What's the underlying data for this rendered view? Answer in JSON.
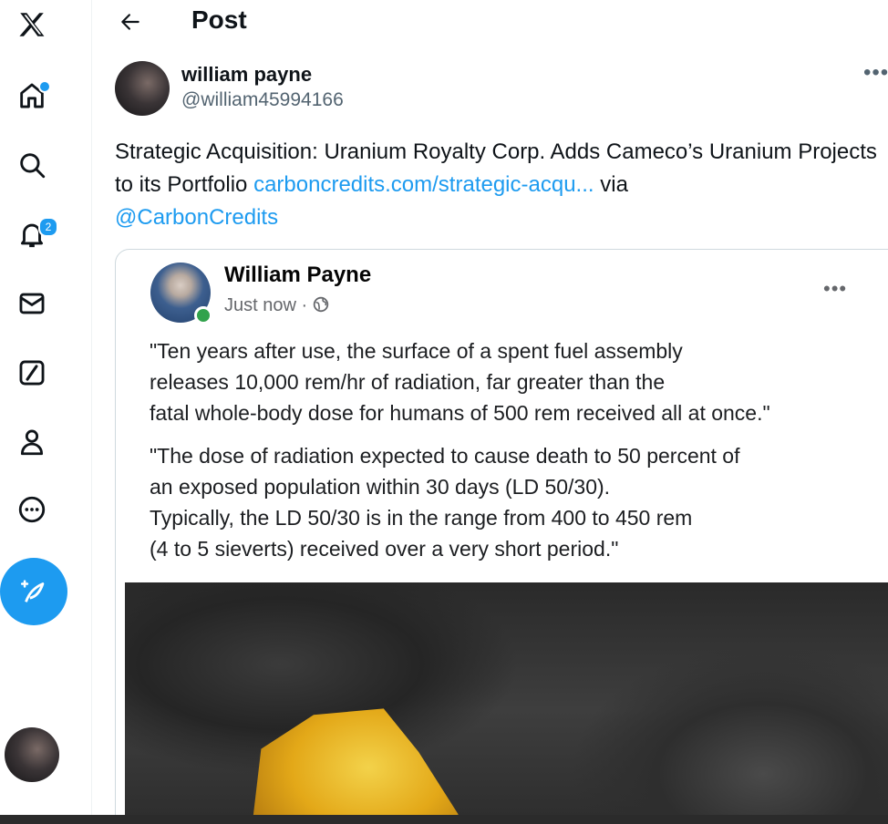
{
  "nav": {
    "logo": "x-logo-icon",
    "items": [
      "home-icon",
      "search-icon",
      "notifications-icon",
      "messages-icon",
      "grok-icon",
      "profile-icon",
      "more-icon"
    ],
    "notification_count": "2"
  },
  "header": {
    "title": "Post"
  },
  "post": {
    "author_name": "william payne",
    "author_handle": "@william45994166",
    "text_1": "Strategic Acquisition: Uranium Royalty Corp. Adds Cameco’s Uranium Projects to its Portfolio ",
    "link": "carboncredits.com/strategic-acqu...",
    "text_2": " via ",
    "mention": "@CarbonCredits"
  },
  "card": {
    "name": "William Payne",
    "time": "Just now · ",
    "para_1_line_1": "\"Ten years after use, the surface of a spent fuel assembly",
    "para_1_line_2": "releases 10,000 rem/hr of radiation, far greater than the",
    "para_1_line_3": "fatal whole-body dose for humans of 500 rem received all at once.\"",
    "para_2_line_1": "\"The dose of radiation expected to cause death to 50 percent of",
    "para_2_line_2": "an exposed population within 30 days (LD 50/30).",
    "para_2_line_3": "Typically, the LD 50/30 is in the range from 400 to 450 rem",
    "para_2_line_4": "(4 to 5 sieverts) received over a very short period.\""
  },
  "colors": {
    "accent": "#1d9bf0",
    "text": "#0f1419",
    "muted": "#536471"
  }
}
